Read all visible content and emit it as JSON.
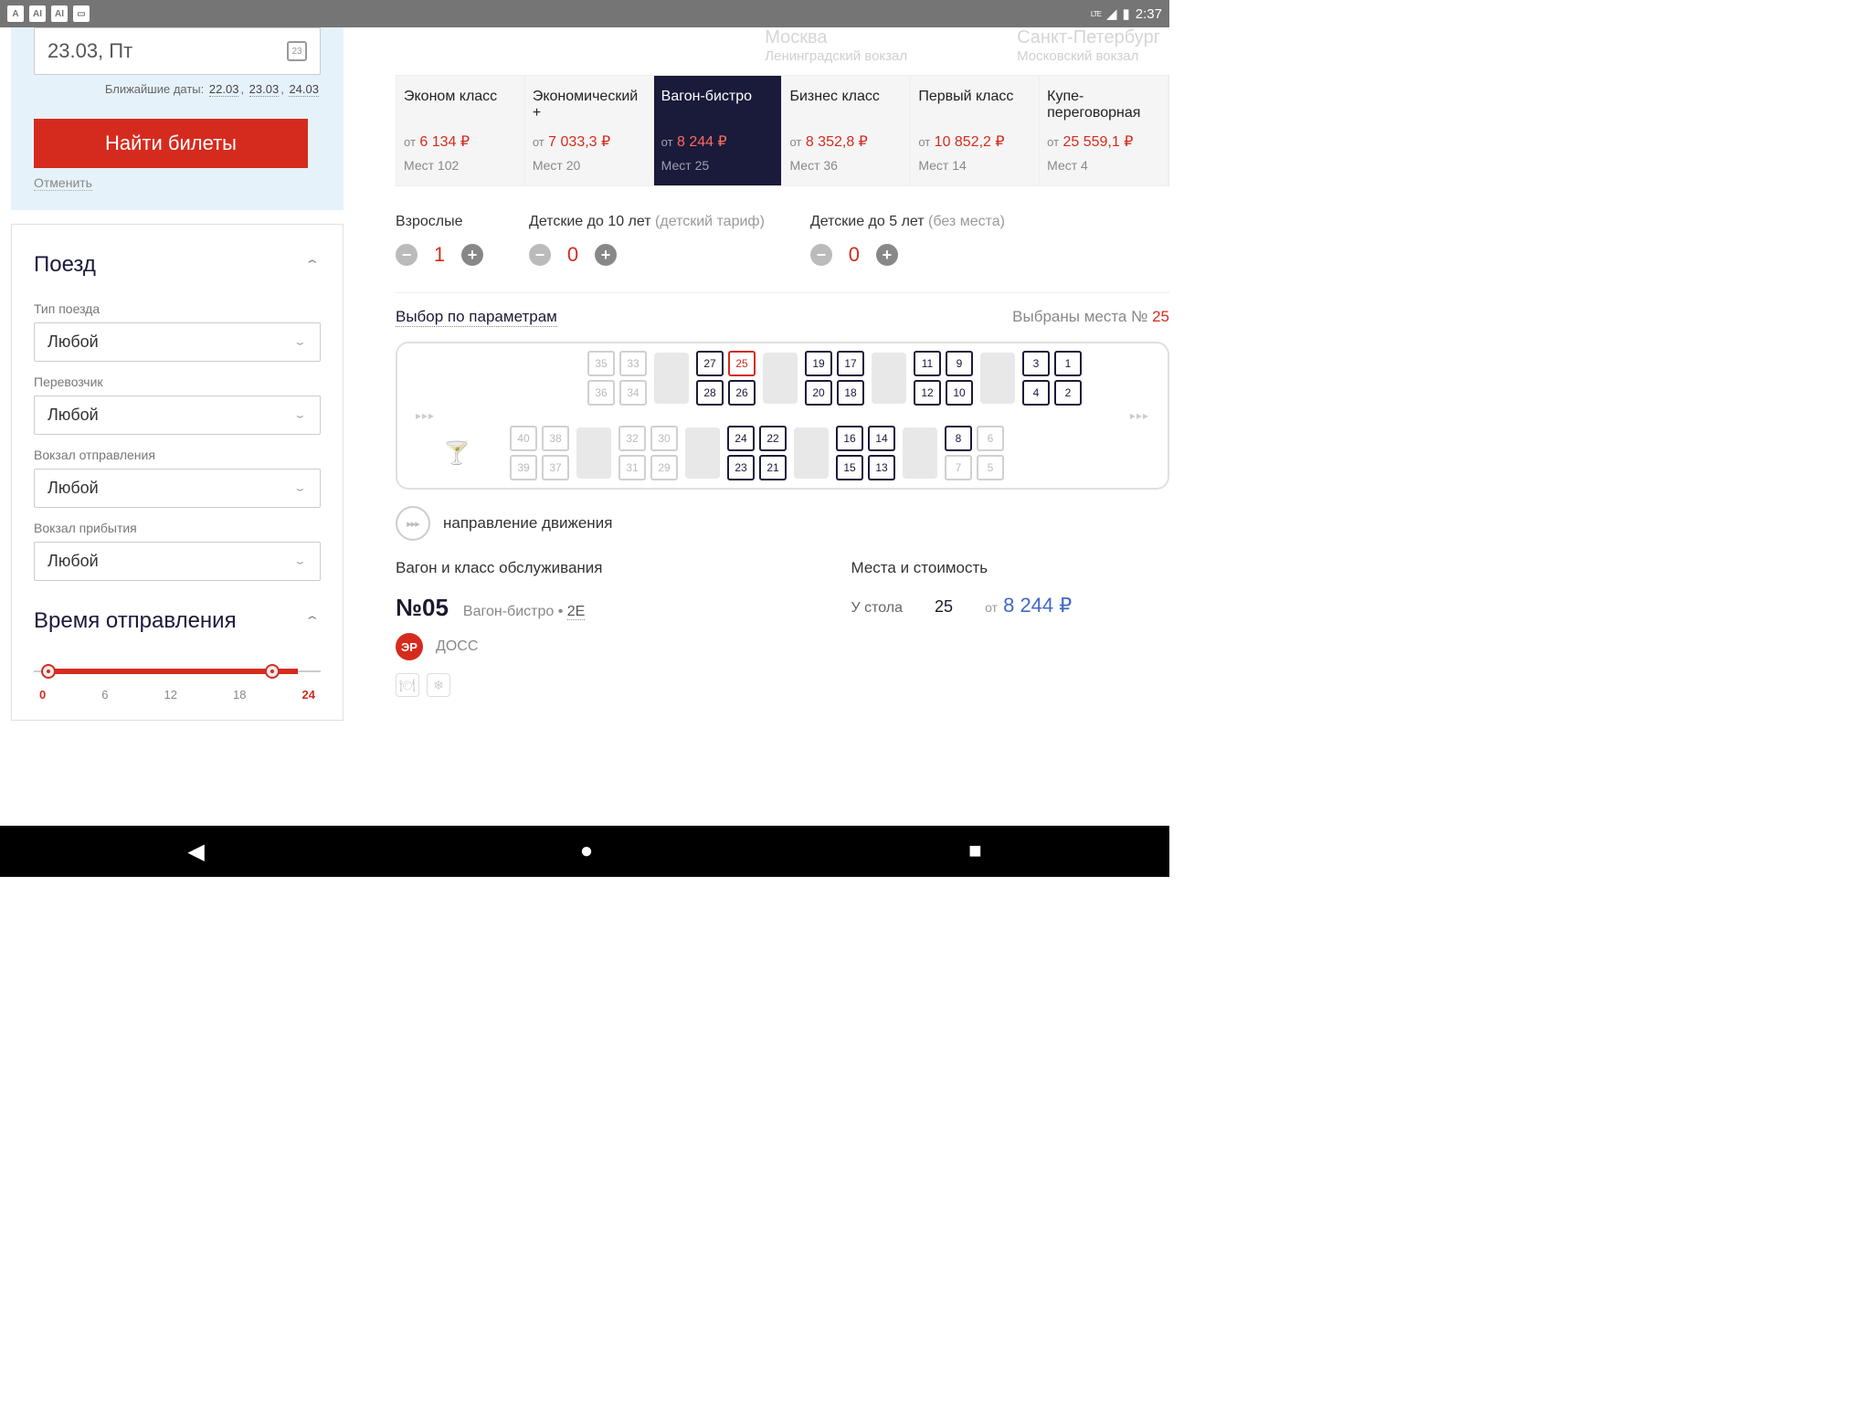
{
  "status": {
    "iconA": "A",
    "iconAI1": "AI",
    "iconAI2": "AI",
    "lte": "LTE",
    "time": "2:37"
  },
  "search": {
    "date": "23.03, Пт",
    "nearest_label": "Ближайшие даты:",
    "dates": [
      "22.03",
      "23.03",
      "24.03"
    ],
    "button": "Найти билеты",
    "cancel": "Отменить"
  },
  "filters": {
    "train_section": "Поезд",
    "train_type_label": "Тип поезда",
    "train_type_value": "Любой",
    "carrier_label": "Перевозчик",
    "carrier_value": "Любой",
    "dep_station_label": "Вокзал отправления",
    "dep_station_value": "Любой",
    "arr_station_label": "Вокзал прибытия",
    "arr_station_value": "Любой",
    "time_section": "Время отправления",
    "slider_min": "0",
    "slider_6": "6",
    "slider_12": "12",
    "slider_18": "18",
    "slider_max": "24"
  },
  "route": {
    "from_city": "Москва",
    "from_station": "Ленинградский вокзал",
    "to_city": "Санкт-Петербург",
    "to_station": "Московский вокзал"
  },
  "classes": [
    {
      "name": "Эконом класс",
      "price": "6 134 ₽",
      "seats": "Мест 102"
    },
    {
      "name": "Экономический +",
      "price": "7 033,3 ₽",
      "seats": "Мест 20"
    },
    {
      "name": "Вагон-бистро",
      "price": "8 244 ₽",
      "seats": "Мест 25"
    },
    {
      "name": "Бизнес класс",
      "price": "8 352,8 ₽",
      "seats": "Мест 36"
    },
    {
      "name": "Первый класс",
      "price": "10 852,2 ₽",
      "seats": "Мест 14"
    },
    {
      "name": "Купе-переговорная",
      "price": "25 559,1 ₽",
      "seats": "Мест 4"
    }
  ],
  "ot": "от",
  "passengers": {
    "adults_label": "Взрослые",
    "adults_val": "1",
    "child10_label": "Детские до 10 лет ",
    "child10_sub": "(детский тариф)",
    "child10_val": "0",
    "child5_label": "Детские до 5 лет ",
    "child5_sub": "(без места)",
    "child5_val": "0"
  },
  "params": {
    "link": "Выбор по параметрам",
    "selected_label": "Выбраны места №",
    "selected_num": "25"
  },
  "seats_top": {
    "r1": [
      "35",
      "33",
      "27",
      "25",
      "19",
      "17",
      "11",
      "9",
      "3",
      "1"
    ],
    "r2": [
      "36",
      "34",
      "28",
      "26",
      "20",
      "18",
      "12",
      "10",
      "4",
      "2"
    ]
  },
  "seats_bottom": {
    "r1": [
      "40",
      "38",
      "32",
      "30",
      "24",
      "22",
      "16",
      "14",
      "8",
      "6"
    ],
    "r2": [
      "39",
      "37",
      "31",
      "29",
      "23",
      "21",
      "15",
      "13",
      "7",
      "5"
    ]
  },
  "seat_avail_top": {
    "35": 0,
    "36": 0,
    "33": 0,
    "34": 0,
    "27": 1,
    "28": 1,
    "25": 2,
    "26": 1,
    "19": 1,
    "20": 1,
    "17": 1,
    "18": 1,
    "11": 1,
    "12": 1,
    "9": 1,
    "10": 1,
    "3": 1,
    "4": 1,
    "1": 1,
    "2": 1
  },
  "seat_avail_bottom": {
    "40": 0,
    "39": 0,
    "38": 0,
    "37": 0,
    "32": 0,
    "31": 0,
    "30": 0,
    "29": 0,
    "24": 1,
    "23": 1,
    "22": 1,
    "21": 1,
    "16": 1,
    "15": 1,
    "14": 1,
    "13": 1,
    "8": 1,
    "7": 0,
    "6": 0,
    "5": 0
  },
  "direction": "направление движения",
  "car": {
    "service_label": "Вагон и класс обслуживания",
    "num": "№05",
    "class_name": "Вагон-бистро",
    "class_code": "2Е",
    "er": "ЭР",
    "doss": "ДОСС"
  },
  "seat_cost": {
    "label": "Места и стоимость",
    "pos_label": "У стола",
    "seat_num": "25",
    "price": "8 244 ₽"
  }
}
